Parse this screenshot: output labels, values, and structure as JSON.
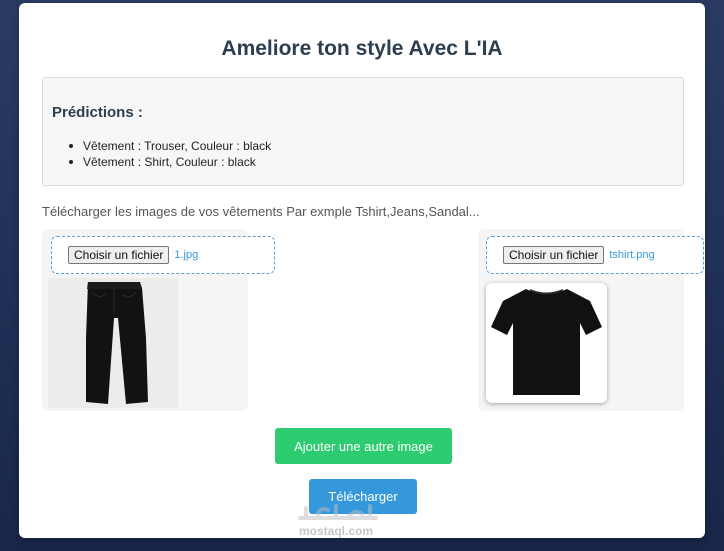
{
  "title": "Ameliore ton style Avec L'IA",
  "predictions": {
    "heading": "Prédictions :",
    "items": [
      "Vêtement : Trouser, Couleur : black",
      "Vêtement : Shirt, Couleur : black"
    ]
  },
  "hint": "Télécharger les images de vos vêtements Par exmple Tshirt,Jeans,Sandal...",
  "uploads": [
    {
      "button_label": "Choisir un fichier",
      "file_name": "1.jpg",
      "image": "trouser-image"
    },
    {
      "button_label": "Choisir un fichier",
      "file_name": "tshirt.png",
      "image": "tshirt-image"
    }
  ],
  "buttons": {
    "add_image": "Ajouter une autre image",
    "upload": "Télécharger"
  },
  "watermark": {
    "text": "mostaql.com"
  },
  "colors": {
    "title": "#2c3e50",
    "add_button": "#2ecc71",
    "upload_button": "#3498db",
    "file_name": "#3498db",
    "background": "#1b2a4a"
  }
}
